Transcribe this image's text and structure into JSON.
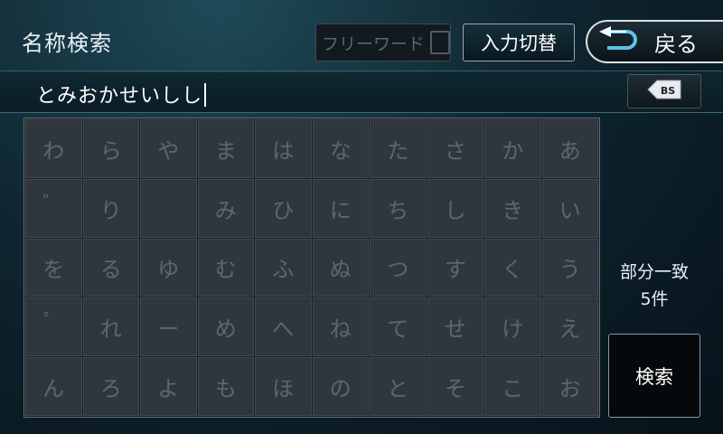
{
  "header": {
    "title": "名称検索",
    "free_word_label": "フリーワード",
    "input_switch_label": "入力切替",
    "back_label": "戻る"
  },
  "input": {
    "value": "とみおかせいしし",
    "backspace_label": "BS"
  },
  "keyboard": {
    "rows": [
      [
        "わ",
        "ら",
        "や",
        "ま",
        "は",
        "な",
        "た",
        "さ",
        "か",
        "あ"
      ],
      [
        "\"",
        "り",
        "",
        "み",
        "ひ",
        "に",
        "ち",
        "し",
        "き",
        "い"
      ],
      [
        "を",
        "る",
        "ゆ",
        "む",
        "ふ",
        "ぬ",
        "つ",
        "す",
        "く",
        "う"
      ],
      [
        "°",
        "れ",
        "ー",
        "め",
        "へ",
        "ね",
        "て",
        "せ",
        "け",
        "え"
      ],
      [
        "ん",
        "ろ",
        "よ",
        "も",
        "ほ",
        "の",
        "と",
        "そ",
        "こ",
        "お"
      ]
    ]
  },
  "result": {
    "match_mode": "部分一致",
    "count": "5件"
  },
  "search_label": "検索"
}
